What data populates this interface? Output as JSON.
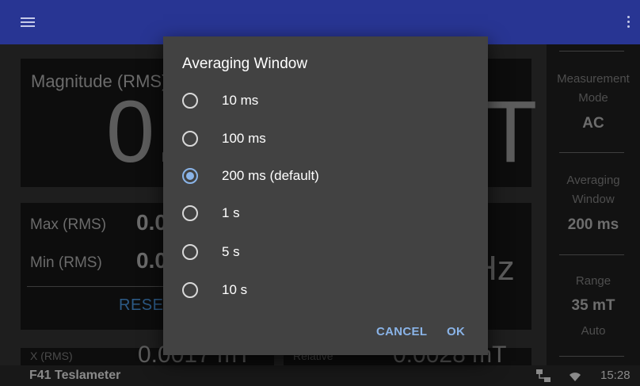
{
  "appbar": {
    "menu_icon": "hamburger-menu-icon",
    "overflow_icon": "overflow-menu-icon",
    "color": "#283593"
  },
  "main": {
    "magnitude": {
      "label": "Magnitude (RMS)",
      "value": "0.",
      "unit": "T"
    },
    "stats": {
      "max_label": "Max (RMS)",
      "max_value": "0.0",
      "min_label": "Min (RMS)",
      "min_value": "0.0",
      "reset_label": "RESET"
    },
    "frequency": {
      "unit": "Hz"
    },
    "bottom_left": {
      "label": "X (RMS)",
      "value": "0.0017 mT"
    },
    "bottom_right": {
      "label": "Relative",
      "value": "0.0028 mT"
    }
  },
  "sidepanel": {
    "measurement_mode": {
      "label": "Measurement Mode",
      "value": "AC"
    },
    "averaging_window": {
      "label": "Averaging Window",
      "value": "200 ms"
    },
    "range": {
      "label": "Range",
      "value": "35 mT",
      "sub": "Auto"
    }
  },
  "statusbar": {
    "title": "F41 Teslameter",
    "time": "15:28",
    "network_icon": "ethernet-icon",
    "wifi_icon": "wifi-icon"
  },
  "dialog": {
    "title": "Averaging Window",
    "options": [
      {
        "label": "10 ms",
        "selected": false
      },
      {
        "label": "100 ms",
        "selected": false
      },
      {
        "label": "200 ms (default)",
        "selected": true
      },
      {
        "label": "1 s",
        "selected": false
      },
      {
        "label": "5 s",
        "selected": false
      },
      {
        "label": "10 s",
        "selected": false
      }
    ],
    "cancel_label": "CANCEL",
    "ok_label": "OK",
    "accent_color": "#8ab4e8"
  }
}
